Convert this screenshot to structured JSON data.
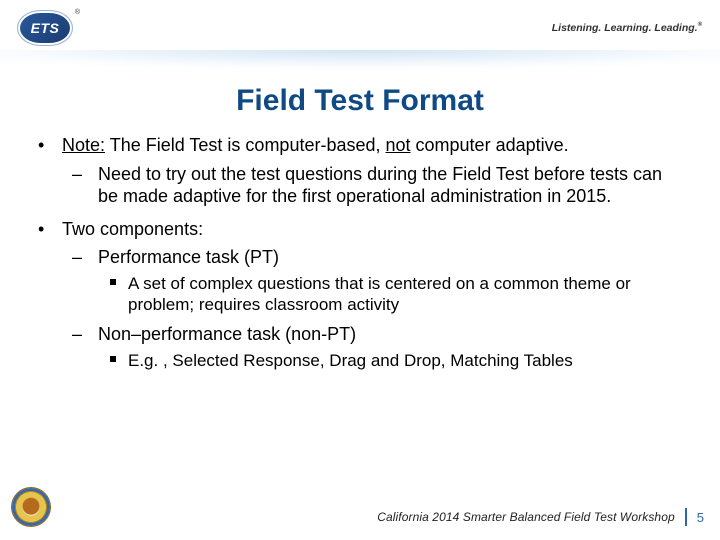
{
  "header": {
    "logo_text": "ETS",
    "tagline": "Listening. Learning. Leading."
  },
  "title": "Field Test Format",
  "bullets": [
    {
      "runs": [
        {
          "text": "Note:",
          "underline": true
        },
        {
          "text": " The Field Test is computer-based, "
        },
        {
          "text": "not",
          "underline": true
        },
        {
          "text": " computer adaptive."
        }
      ],
      "sub_dash": [
        {
          "text": "Need to try out the test questions during the Field Test before tests can be made adaptive for the first operational administration in 2015."
        }
      ]
    },
    {
      "text": "Two components:",
      "sub_dash": [
        {
          "text": "Performance task (PT)",
          "sub_square": [
            {
              "text": "A set of complex questions that is centered on a common theme or problem; requires classroom activity"
            }
          ]
        },
        {
          "text": "Non–performance task (non-PT)",
          "sub_square": [
            {
              "text": "E.g. , Selected Response, Drag and Drop, Matching Tables"
            }
          ]
        }
      ]
    }
  ],
  "footer": {
    "text": "California 2014 Smarter Balanced Field Test Workshop",
    "page": "5"
  }
}
